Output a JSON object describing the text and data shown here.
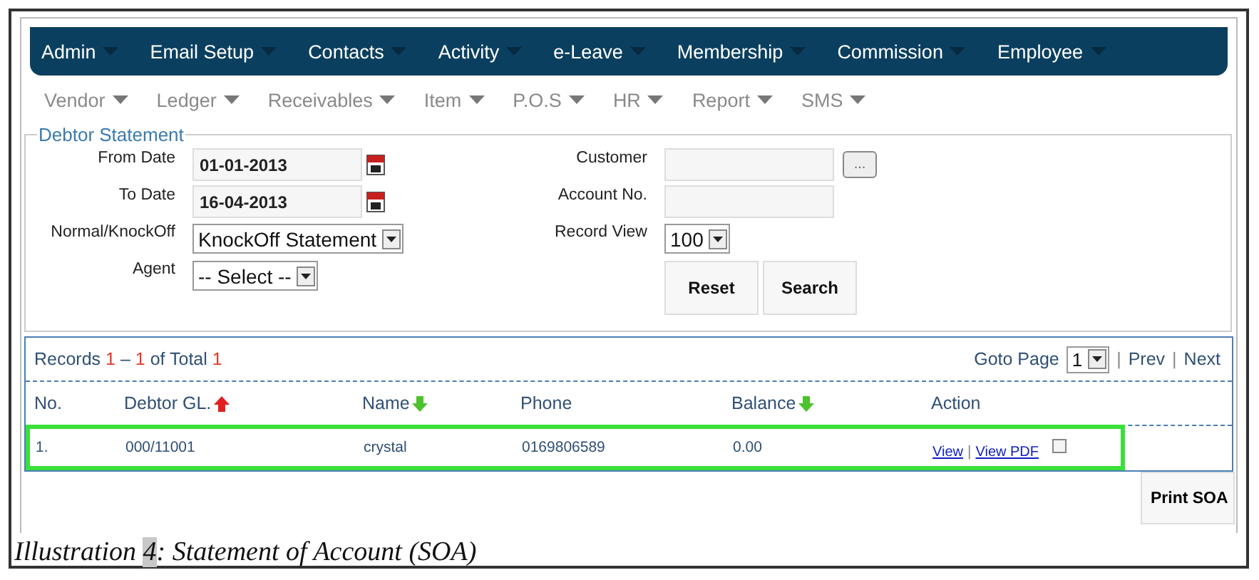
{
  "main_menu": [
    {
      "label": "Admin"
    },
    {
      "label": "Email Setup"
    },
    {
      "label": "Contacts"
    },
    {
      "label": "Activity"
    },
    {
      "label": "e-Leave"
    },
    {
      "label": "Membership"
    },
    {
      "label": "Commission"
    },
    {
      "label": "Employee"
    }
  ],
  "sub_menu": [
    {
      "label": "Vendor"
    },
    {
      "label": "Ledger"
    },
    {
      "label": "Receivables"
    },
    {
      "label": "Item"
    },
    {
      "label": "P.O.S"
    },
    {
      "label": "HR"
    },
    {
      "label": "Report"
    },
    {
      "label": "SMS"
    }
  ],
  "form": {
    "title": "Debtor Statement",
    "from_date": {
      "label": "From Date",
      "value": "01-01-2013"
    },
    "to_date": {
      "label": "To Date",
      "value": "16-04-2013"
    },
    "statement_type": {
      "label": "Normal/KnockOff",
      "value": "KnockOff Statement"
    },
    "agent": {
      "label": "Agent",
      "value": "-- Select --"
    },
    "customer": {
      "label": "Customer",
      "browse": "..."
    },
    "account_no": {
      "label": "Account No."
    },
    "record_view": {
      "label": "Record View",
      "value": "100"
    },
    "buttons": [
      "Reset",
      "Search"
    ]
  },
  "results": {
    "records": {
      "prefix": "Records",
      "from": "1",
      "dash": "–",
      "to": "1",
      "of": "of Total",
      "total": "1"
    },
    "goto_label": "Goto Page",
    "page": "1",
    "sep1": "|",
    "prev": "Prev",
    "sep2": "|",
    "next": "Next",
    "columns": [
      {
        "label": "No.",
        "sorted_up": false,
        "sorted_down": false
      },
      {
        "label": "Debtor GL.",
        "sorted_up": true,
        "sorted_down": false
      },
      {
        "label": "Name",
        "sorted_up": false,
        "sorted_down": true
      },
      {
        "label": "Phone",
        "sorted_up": false,
        "sorted_down": false
      },
      {
        "label": "Balance",
        "sorted_up": false,
        "sorted_down": true
      },
      {
        "label": "Action",
        "sorted_up": false,
        "sorted_down": false
      }
    ],
    "rows": [
      {
        "no": "1.",
        "debtor_gl": "000/11001",
        "name": "crystal",
        "phone": "0169806589",
        "balance": "0.00",
        "view": "View",
        "sep": "|",
        "view_pdf": "View PDF",
        "checked": false,
        "highlighted": true
      }
    ],
    "print_button": "Print SOA"
  },
  "caption": {
    "label": "Illustration",
    "number": "4",
    "title": ": Statement of Account (SOA)"
  }
}
